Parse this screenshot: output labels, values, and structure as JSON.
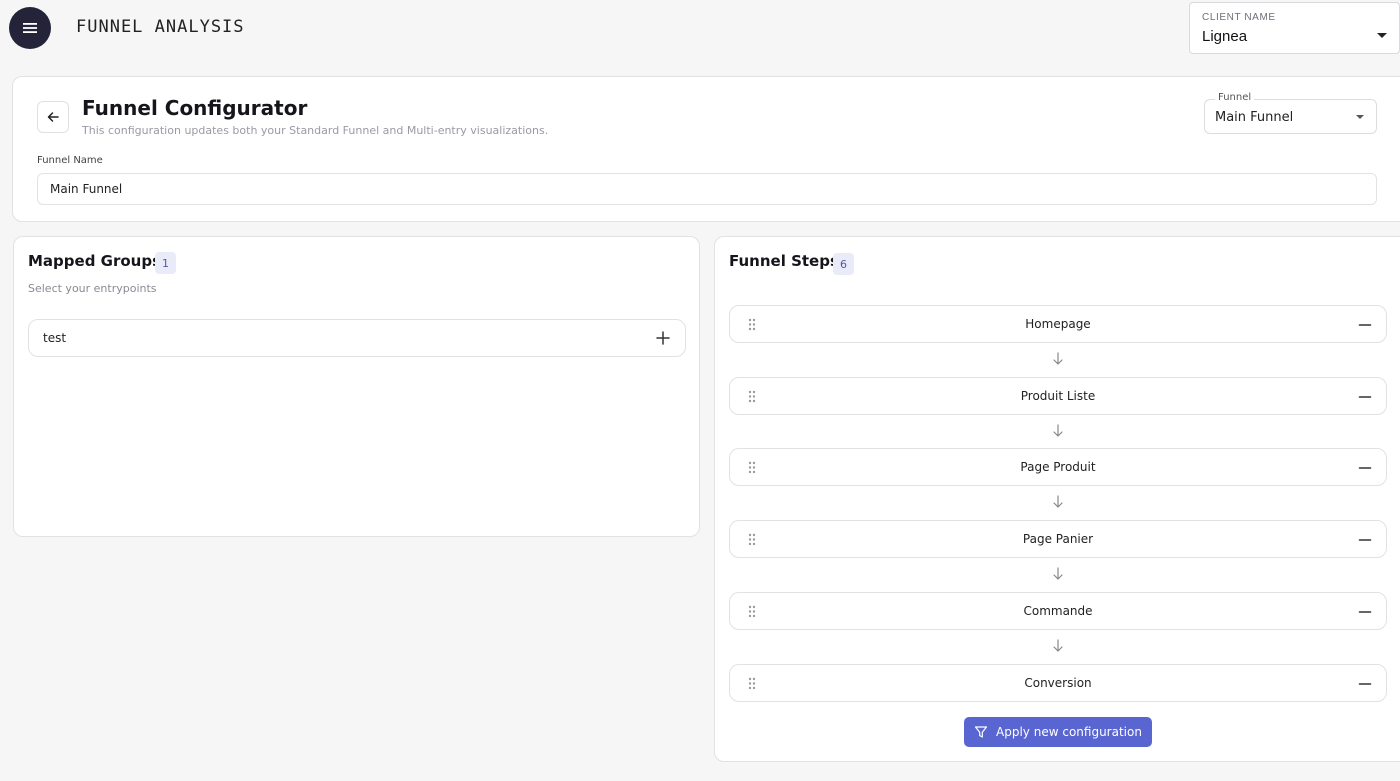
{
  "header": {
    "app_title": "FUNNEL ANALYSIS",
    "client": {
      "label": "CLIENT NAME",
      "value": "Lignea"
    }
  },
  "config": {
    "title": "Funnel Configurator",
    "subtitle": "This configuration updates both your Standard Funnel and Multi-entry visualizations.",
    "funnel_select": {
      "label": "Funnel",
      "value": "Main Funnel"
    },
    "funnel_name": {
      "label": "Funnel Name",
      "value": "Main Funnel"
    }
  },
  "groups": {
    "title": "Mapped Groups",
    "count": "1",
    "subtitle": "Select your entrypoints",
    "items": [
      {
        "label": "test"
      }
    ]
  },
  "steps": {
    "title": "Funnel Steps",
    "count": "6",
    "items": [
      {
        "label": "Homepage"
      },
      {
        "label": "Produit Liste"
      },
      {
        "label": "Page Produit"
      },
      {
        "label": "Page Panier"
      },
      {
        "label": "Commande"
      },
      {
        "label": "Conversion"
      }
    ],
    "apply_label": "Apply new configuration"
  },
  "colors": {
    "accent": "#5965d1",
    "badge_bg": "#e9ebf8",
    "menu_bg": "#23233a"
  }
}
